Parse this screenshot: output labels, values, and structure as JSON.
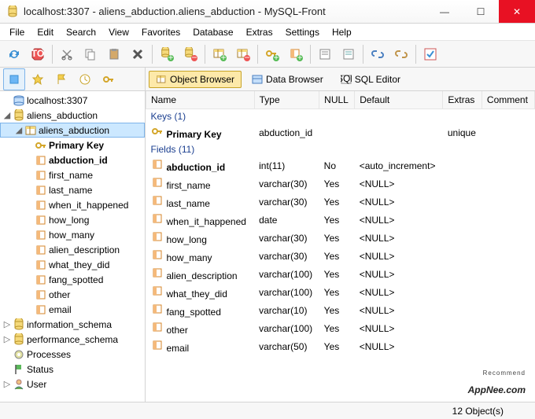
{
  "window": {
    "title": "localhost:3307 - aliens_abduction.aliens_abduction - MySQL-Front"
  },
  "menu": [
    "File",
    "Edit",
    "Search",
    "View",
    "Favorites",
    "Database",
    "Extras",
    "Settings",
    "Help"
  ],
  "tabs": {
    "object": "Object Browser",
    "data": "Data Browser",
    "sql": "SQL Editor"
  },
  "tree": {
    "host": "localhost:3307",
    "db": "aliens_abduction",
    "table": "aliens_abduction",
    "columns": [
      "Primary Key",
      "abduction_id",
      "first_name",
      "last_name",
      "when_it_happened",
      "how_long",
      "how_many",
      "alien_description",
      "what_they_did",
      "fang_spotted",
      "other",
      "email"
    ],
    "sys": [
      "information_schema",
      "performance_schema",
      "Processes",
      "Status",
      "User"
    ]
  },
  "grid": {
    "headers": [
      "Name",
      "Type",
      "NULL",
      "Default",
      "Extras",
      "Comment"
    ],
    "keys_label": "Keys (1)",
    "fields_label": "Fields (11)",
    "pk": {
      "name": "Primary Key",
      "type": "abduction_id",
      "nul": "",
      "def": "",
      "extras": "unique",
      "comment": ""
    },
    "rows": [
      {
        "name": "abduction_id",
        "type": "int(11)",
        "nul": "No",
        "def": "<auto_increment>",
        "bold": true
      },
      {
        "name": "first_name",
        "type": "varchar(30)",
        "nul": "Yes",
        "def": "<NULL>"
      },
      {
        "name": "last_name",
        "type": "varchar(30)",
        "nul": "Yes",
        "def": "<NULL>"
      },
      {
        "name": "when_it_happened",
        "type": "date",
        "nul": "Yes",
        "def": "<NULL>"
      },
      {
        "name": "how_long",
        "type": "varchar(30)",
        "nul": "Yes",
        "def": "<NULL>"
      },
      {
        "name": "how_many",
        "type": "varchar(30)",
        "nul": "Yes",
        "def": "<NULL>"
      },
      {
        "name": "alien_description",
        "type": "varchar(100)",
        "nul": "Yes",
        "def": "<NULL>"
      },
      {
        "name": "what_they_did",
        "type": "varchar(100)",
        "nul": "Yes",
        "def": "<NULL>"
      },
      {
        "name": "fang_spotted",
        "type": "varchar(10)",
        "nul": "Yes",
        "def": "<NULL>"
      },
      {
        "name": "other",
        "type": "varchar(100)",
        "nul": "Yes",
        "def": "<NULL>"
      },
      {
        "name": "email",
        "type": "varchar(50)",
        "nul": "Yes",
        "def": "<NULL>"
      }
    ]
  },
  "status": "12 Object(s)",
  "watermark": {
    "text": "AppNee.com",
    "tag": "Recommend"
  }
}
